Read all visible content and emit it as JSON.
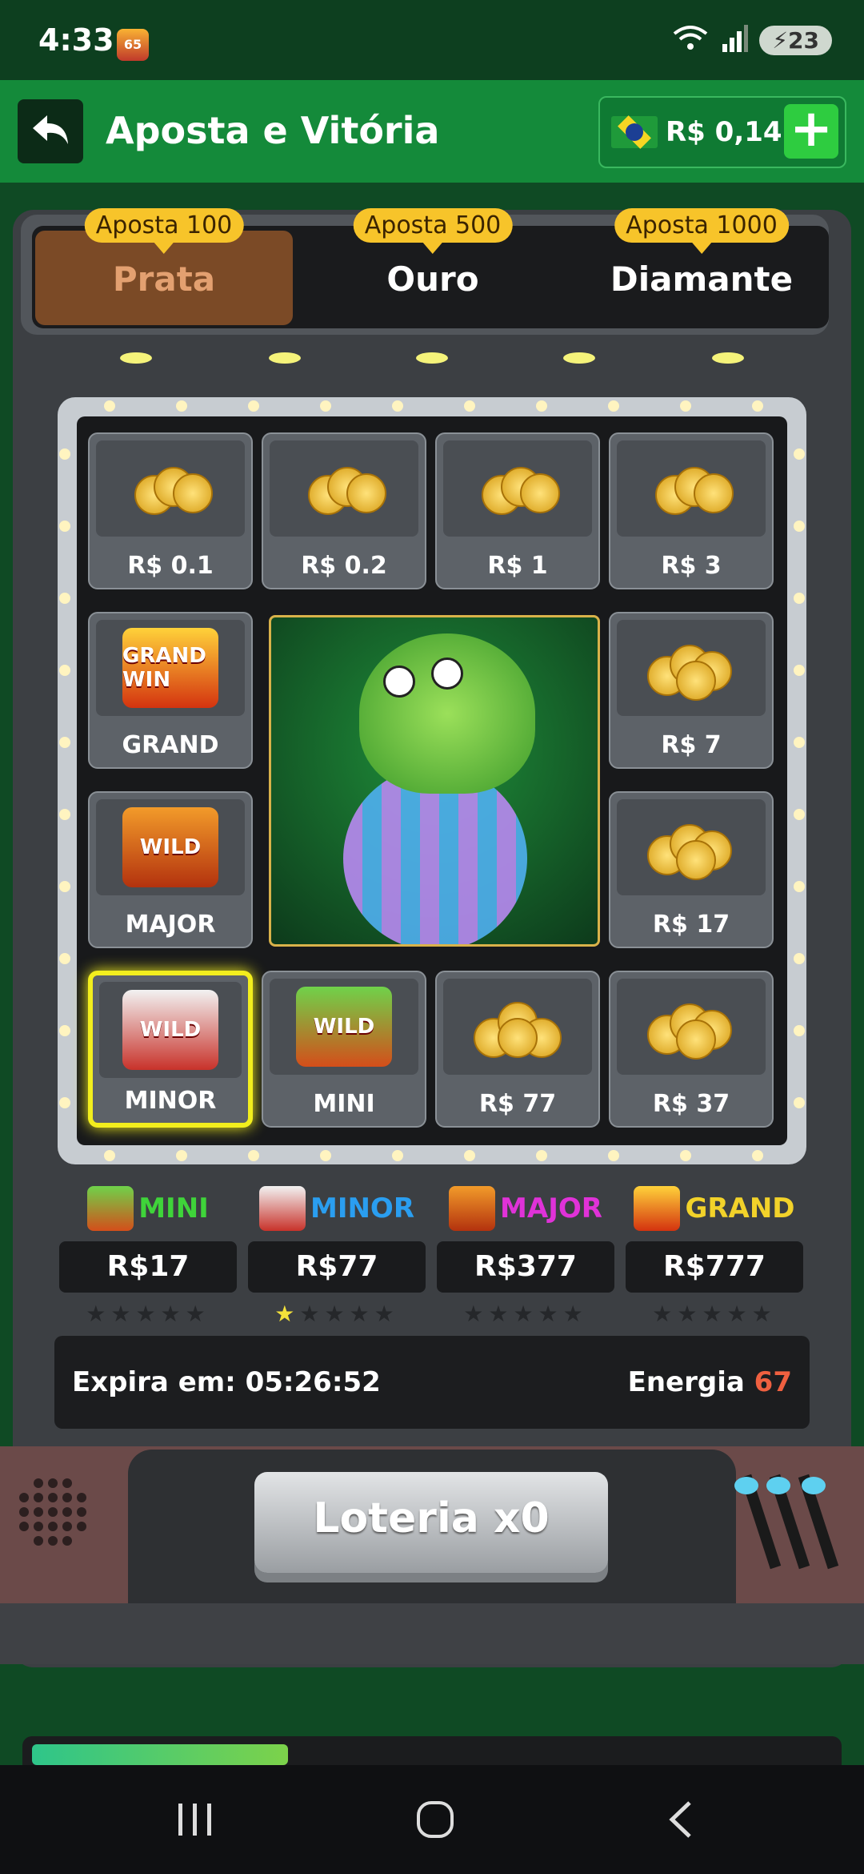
{
  "status": {
    "time": "4:33",
    "app_badge": "65",
    "signal_label": "6",
    "battery": "23"
  },
  "header": {
    "title": "Aposta e Vitória",
    "balance": "R$ 0,14",
    "add_label": "+"
  },
  "tabs": [
    {
      "label": "Prata",
      "badge": "Aposta 100",
      "active": true
    },
    {
      "label": "Ouro",
      "badge": "Aposta 500",
      "active": false
    },
    {
      "label": "Diamante",
      "badge": "Aposta 1000",
      "active": false
    }
  ],
  "grid": {
    "row1": [
      "R$ 0.1",
      "R$ 0.2",
      "R$ 1",
      "R$ 3"
    ],
    "left": [
      "GRAND",
      "MAJOR"
    ],
    "right": [
      "R$ 7",
      "R$ 17"
    ],
    "row4": [
      "MINOR",
      "MINI",
      "R$ 77",
      "R$ 37"
    ],
    "grand_art": "GRAND WIN",
    "wild_art": "WILD"
  },
  "jackpots": [
    {
      "name": "MINI",
      "value": "R$17",
      "stars_lit": 0,
      "color": "#3fd43a"
    },
    {
      "name": "MINOR",
      "value": "R$77",
      "stars_lit": 1,
      "color": "#2a9ef0"
    },
    {
      "name": "MAJOR",
      "value": "R$377",
      "stars_lit": 0,
      "color": "#e032d8"
    },
    {
      "name": "GRAND",
      "value": "R$777",
      "stars_lit": 0,
      "color": "#f2d22a"
    }
  ],
  "info": {
    "expire": "Expira em: 05:26:52",
    "energy_label": "Energia",
    "energy_value": "67"
  },
  "lottery": {
    "label": "Loteria x0"
  },
  "progress": {
    "fraction": 0.32
  },
  "colors": {
    "header": "#148a3a",
    "accent": "#f7c42a",
    "highlight": "#f2ee1d"
  }
}
